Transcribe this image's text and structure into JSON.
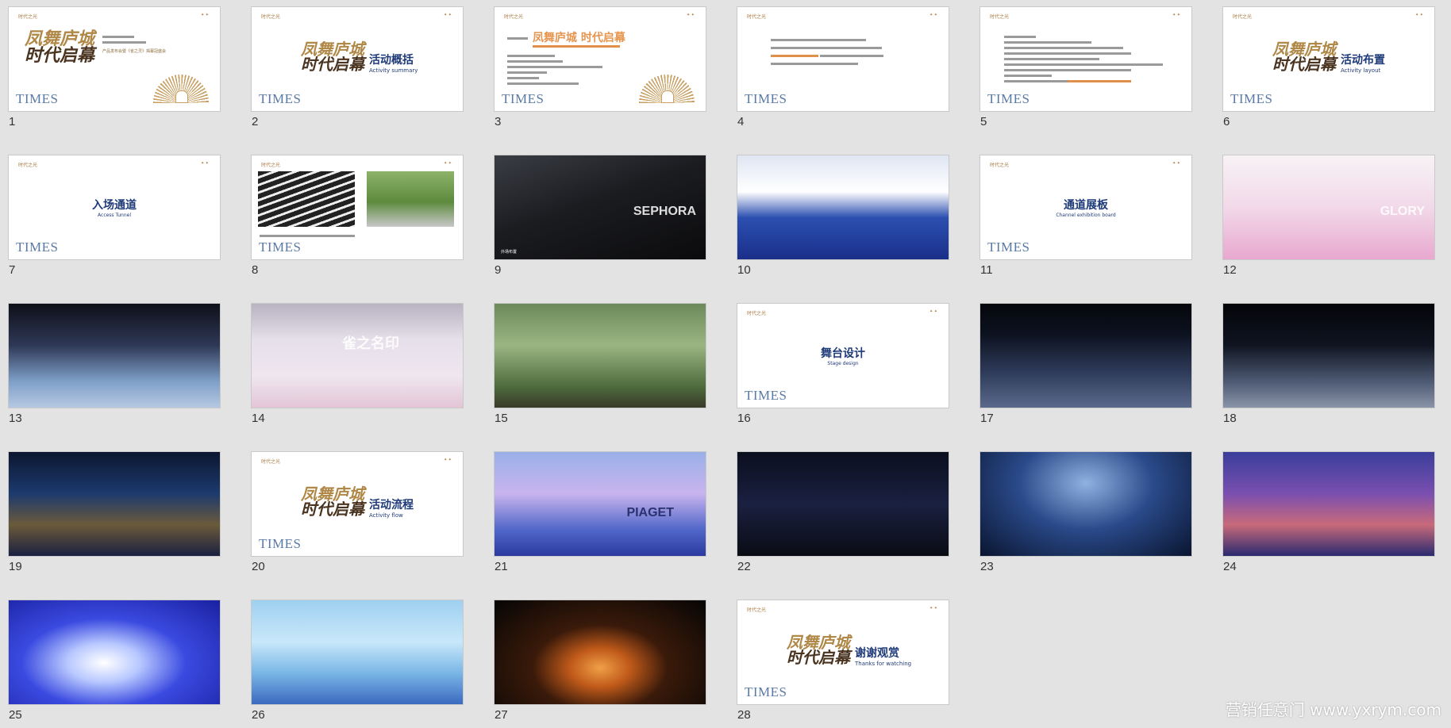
{
  "slides": [
    {
      "num": "1",
      "kind": "cover",
      "subtitle": "产品发布会暨《雀之灵》揭幕冠盛会"
    },
    {
      "num": "2",
      "kind": "section",
      "title": "活动概括",
      "sub": "Activity summary"
    },
    {
      "num": "3",
      "kind": "overview",
      "title": "凤舞庐城 时代启幕"
    },
    {
      "num": "4",
      "kind": "text"
    },
    {
      "num": "5",
      "kind": "text2"
    },
    {
      "num": "6",
      "kind": "section",
      "title": "活动布置",
      "sub": "Activity layout"
    },
    {
      "num": "7",
      "kind": "section-plain",
      "title": "入场通道",
      "sub": "Access Tunnel"
    },
    {
      "num": "8",
      "kind": "photos2"
    },
    {
      "num": "9",
      "kind": "photo",
      "caption": "外场布置",
      "sign": "SEPHORA"
    },
    {
      "num": "10",
      "kind": "photo"
    },
    {
      "num": "11",
      "kind": "section-plain",
      "title": "通道展板",
      "sub": "Channel exhibition board"
    },
    {
      "num": "12",
      "kind": "photo",
      "sign": "GLORY"
    },
    {
      "num": "13",
      "kind": "photo"
    },
    {
      "num": "14",
      "kind": "photo",
      "sign": "雀之名印"
    },
    {
      "num": "15",
      "kind": "photo"
    },
    {
      "num": "16",
      "kind": "section-plain",
      "title": "舞台设计",
      "sub": "Stage design"
    },
    {
      "num": "17",
      "kind": "photo"
    },
    {
      "num": "18",
      "kind": "photo"
    },
    {
      "num": "19",
      "kind": "photo"
    },
    {
      "num": "20",
      "kind": "section",
      "title": "活动流程",
      "sub": "Activity flow"
    },
    {
      "num": "21",
      "kind": "photo",
      "sign": "PIAGET"
    },
    {
      "num": "22",
      "kind": "photo"
    },
    {
      "num": "23",
      "kind": "photo"
    },
    {
      "num": "24",
      "kind": "photo"
    },
    {
      "num": "25",
      "kind": "photo"
    },
    {
      "num": "26",
      "kind": "photo"
    },
    {
      "num": "27",
      "kind": "photo"
    },
    {
      "num": "28",
      "kind": "section",
      "title": "谢谢观赏",
      "sub": "Thanks for watching"
    }
  ],
  "common": {
    "brand": "时代之光",
    "logo_line1": "凤舞庐城",
    "logo_line2": "时代启幕",
    "times": "TIMES"
  },
  "watermark": "营销任意门 www.yxrym.com",
  "colors": {
    "background": "#e3e3e3",
    "title_blue": "#1e3a78",
    "gold": "#b08848",
    "accent_orange": "#e6954e"
  }
}
